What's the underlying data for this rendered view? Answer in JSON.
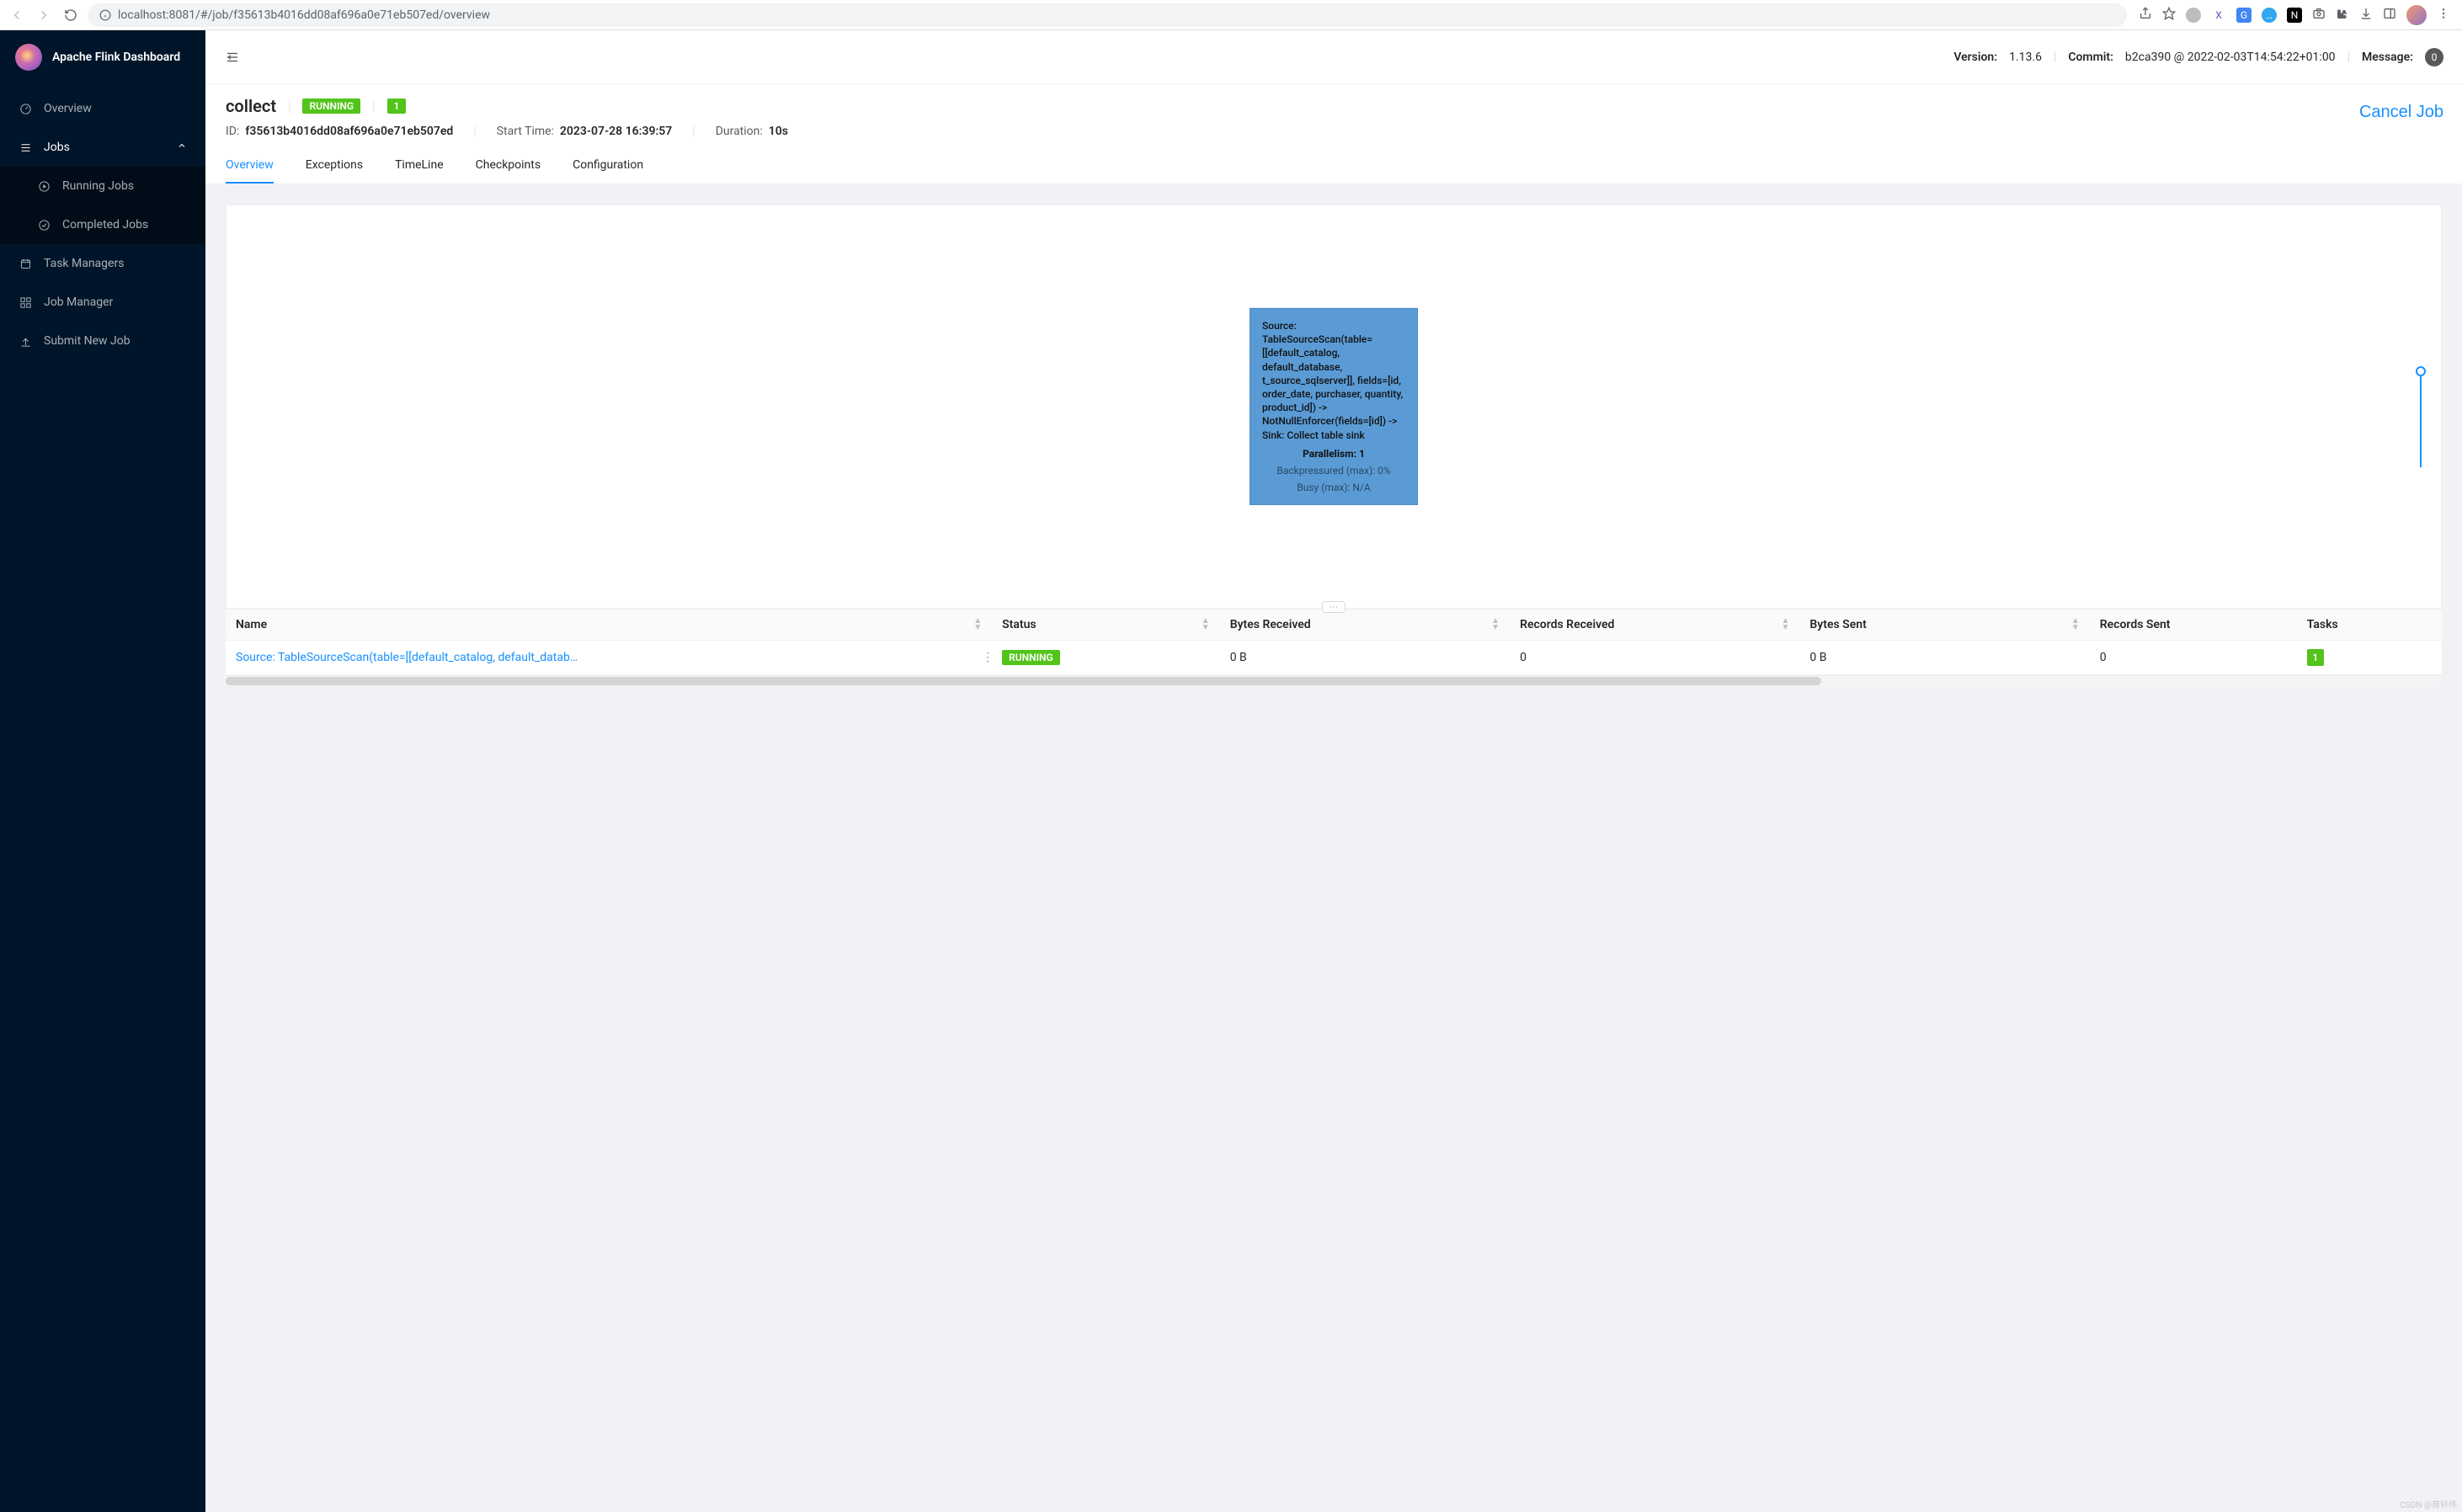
{
  "chrome": {
    "url_display": "localhost:8081/#/job/f35613b4016dd08af696a0e71eb507ed/overview",
    "url_info_icon": "info-icon",
    "ext_colors": [
      "#9e9e9e",
      "#8a6de0",
      "#4285f4",
      "#34a6f0",
      "#000000",
      "#9e9e9e",
      "#000000",
      "#9e9e9e",
      "#5f6368"
    ]
  },
  "sidebar": {
    "title": "Apache Flink Dashboard",
    "items": [
      {
        "icon": "dashboard-icon",
        "label": "Overview"
      },
      {
        "icon": "list-icon",
        "label": "Jobs",
        "expandable": true
      },
      {
        "icon": "task-icon",
        "label": "Task Managers"
      },
      {
        "icon": "cluster-icon",
        "label": "Job Manager"
      },
      {
        "icon": "upload-icon",
        "label": "Submit New Job"
      }
    ],
    "jobs_submenu": [
      {
        "icon": "play-circle-icon",
        "label": "Running Jobs"
      },
      {
        "icon": "check-circle-icon",
        "label": "Completed Jobs"
      }
    ]
  },
  "topbar": {
    "version_label": "Version:",
    "version_value": "1.13.6",
    "commit_label": "Commit:",
    "commit_value": "b2ca390 @ 2022-02-03T14:54:22+01:00",
    "message_label": "Message:",
    "message_count": "0"
  },
  "job": {
    "name": "collect",
    "status_badge": "RUNNING",
    "task_count": "1",
    "id_label": "ID:",
    "id_value": "f35613b4016dd08af696a0e71eb507ed",
    "start_label": "Start Time:",
    "start_value": "2023-07-28 16:39:57",
    "duration_label": "Duration:",
    "duration_value": "10s",
    "cancel_label": "Cancel Job"
  },
  "tabs": [
    {
      "label": "Overview",
      "active": true
    },
    {
      "label": "Exceptions"
    },
    {
      "label": "TimeLine"
    },
    {
      "label": "Checkpoints"
    },
    {
      "label": "Configuration"
    }
  ],
  "graph_node": {
    "description": "Source: TableSourceScan(table=[[default_catalog, default_database, t_source_sqlserver]], fields=[id, order_date, purchaser, quantity, product_id]) -> NotNullEnforcer(fields=[id]) -> Sink: Collect table sink",
    "parallelism": "Parallelism: 1",
    "backpressure": "Backpressured (max): 0%",
    "busy": "Busy (max): N/A"
  },
  "table": {
    "columns": [
      "Name",
      "Status",
      "Bytes Received",
      "Records Received",
      "Bytes Sent",
      "Records Sent",
      "Tasks"
    ],
    "rows": [
      {
        "name": "Source: TableSourceScan(table=[[default_catalog, default_datab…",
        "status": "RUNNING",
        "bytes_received": "0 B",
        "records_received": "0",
        "bytes_sent": "0 B",
        "records_sent": "0",
        "tasks": "1"
      }
    ]
  },
  "colors": {
    "accent": "#1890ff",
    "green": "#52c41a",
    "node": "#5a9bd5",
    "sidebar_bg": "#001529"
  },
  "watermark": "CSDN @蒋轩伟"
}
